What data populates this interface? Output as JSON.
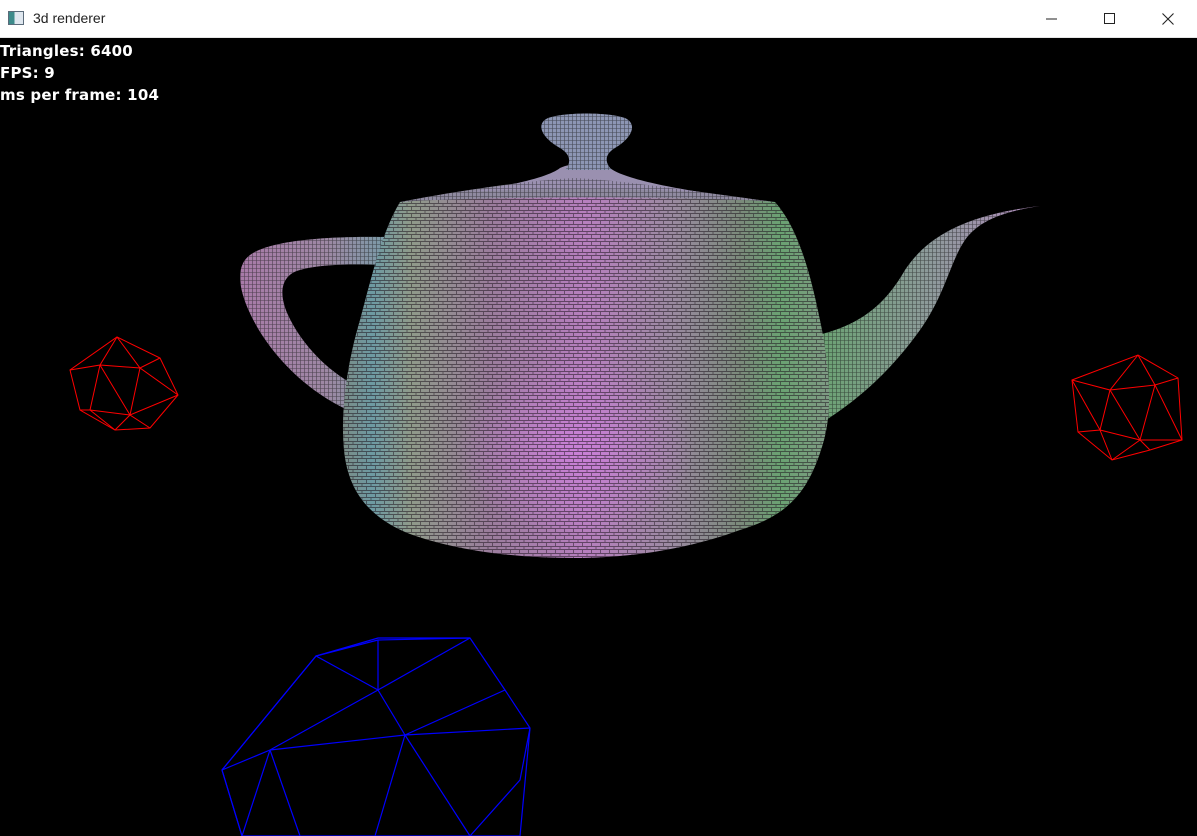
{
  "window": {
    "title": "3d renderer"
  },
  "controls": {
    "minimize": "minimize-icon",
    "maximize": "maximize-icon",
    "close": "close-icon"
  },
  "hud": {
    "triangles": "Triangles: 6400",
    "fps": "FPS: 9",
    "ms_per_frame": "ms per frame: 104"
  },
  "scene": {
    "objects": [
      {
        "name": "teapot",
        "style": "textured-brick",
        "colors": [
          "#c07fc4",
          "#6fa078",
          "#7a9aa6"
        ]
      },
      {
        "name": "icosahedron-left",
        "style": "wireframe",
        "color": "#ff0000"
      },
      {
        "name": "icosahedron-right",
        "style": "wireframe",
        "color": "#ff0000"
      },
      {
        "name": "icosahedron-bottom",
        "style": "wireframe",
        "color": "#0000ff"
      }
    ]
  }
}
